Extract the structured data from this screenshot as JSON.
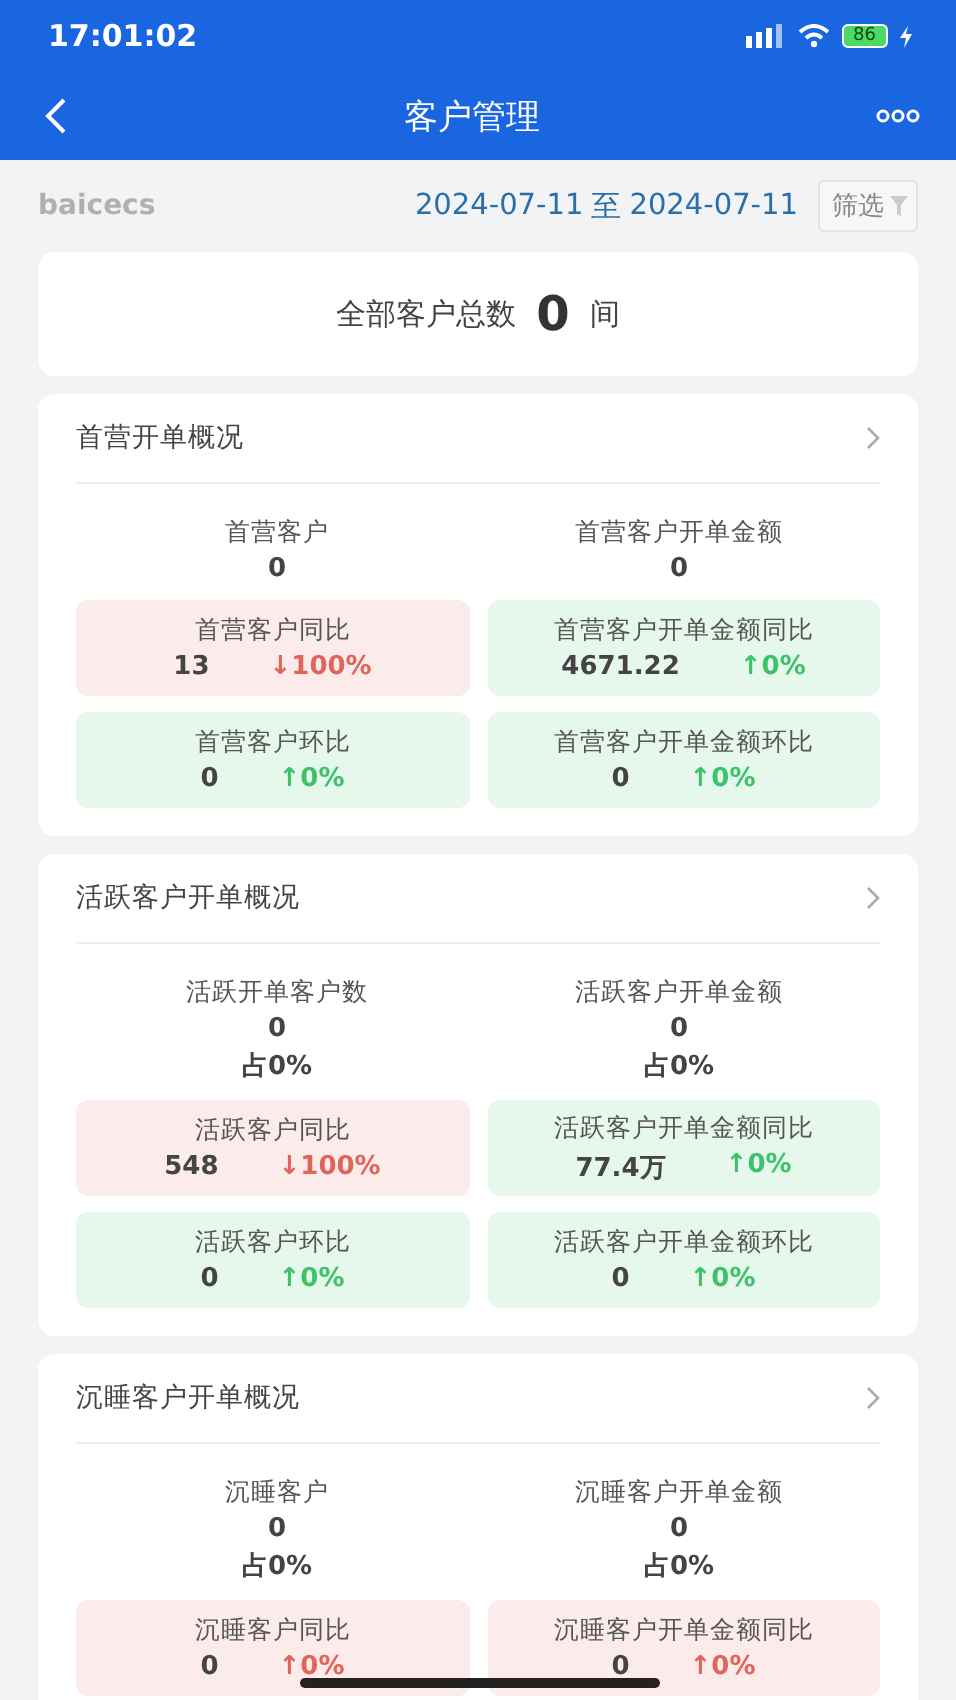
{
  "status_bar": {
    "time": "17:01:02",
    "battery": "86"
  },
  "nav": {
    "title": "客户管理"
  },
  "filter_row": {
    "account": "baicecs",
    "date_from": "2024-07-11",
    "date_sep": "至",
    "date_to": "2024-07-11",
    "filter_button": "筛选"
  },
  "total": {
    "label": "全部客户总数",
    "value": "0",
    "unit": "间"
  },
  "sections": [
    {
      "title": "首营开单概况",
      "metrics": [
        {
          "label": "首营客户",
          "value": "0"
        },
        {
          "label": "首营客户开单金额",
          "value": "0"
        }
      ],
      "tiles": [
        {
          "label": "首营客户同比",
          "value": "13",
          "change": "↓100%",
          "color": "#e0645a"
        },
        {
          "label": "首营客户开单金额同比",
          "value": "4671.22",
          "change": "↑0%",
          "color": "#3cc36a"
        },
        {
          "label": "首营客户环比",
          "value": "0",
          "change": "↑0%",
          "color": "#3cc36a"
        },
        {
          "label": "首营客户开单金额环比",
          "value": "0",
          "change": "↑0%",
          "color": "#3cc36a"
        }
      ]
    },
    {
      "title": "活跃客户开单概况",
      "metrics": [
        {
          "label": "活跃开单客户数",
          "value": "0",
          "share": "占0%"
        },
        {
          "label": "活跃客户开单金额",
          "value": "0",
          "share": "占0%"
        }
      ],
      "tiles": [
        {
          "label": "活跃客户同比",
          "value": "548",
          "change": "↓100%",
          "color": "#e0645a"
        },
        {
          "label": "活跃客户开单金额同比",
          "value": "77.4万",
          "change": "↑0%",
          "color": "#3cc36a"
        },
        {
          "label": "活跃客户环比",
          "value": "0",
          "change": "↑0%",
          "color": "#3cc36a"
        },
        {
          "label": "活跃客户开单金额环比",
          "value": "0",
          "change": "↑0%",
          "color": "#3cc36a"
        }
      ]
    },
    {
      "title": "沉睡客户开单概况",
      "metrics": [
        {
          "label": "沉睡客户",
          "value": "0",
          "share": "占0%"
        },
        {
          "label": "沉睡客户开单金额",
          "value": "0",
          "share": "占0%"
        }
      ],
      "tiles": [
        {
          "label": "沉睡客户同比",
          "value": "0",
          "change": "↑0%",
          "color": "#e0645a"
        },
        {
          "label": "沉睡客户开单金额同比",
          "value": "0",
          "change": "↑0%",
          "color": "#e0645a"
        }
      ]
    }
  ]
}
